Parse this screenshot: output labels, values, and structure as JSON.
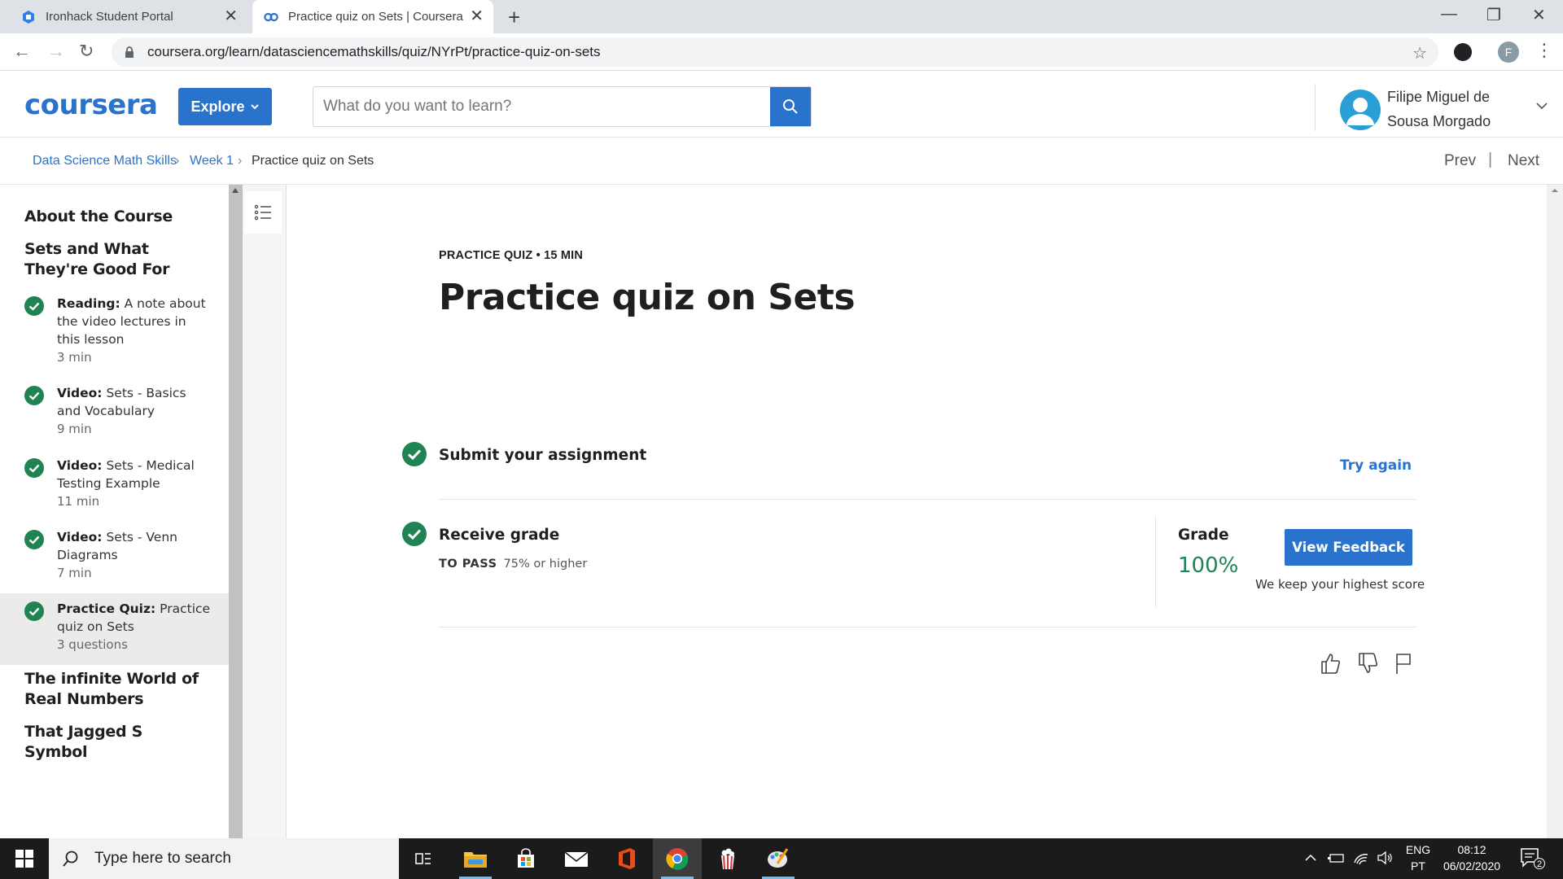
{
  "browser": {
    "tabs": [
      {
        "title": "Ironhack Student Portal",
        "icon": "ironhack-favicon"
      },
      {
        "title": "Practice quiz on Sets | Coursera",
        "icon": "coursera-favicon"
      }
    ],
    "url": "coursera.org/learn/datasciencemathskills/quiz/NYrPt/practice-quiz-on-sets",
    "profile_initial": "F"
  },
  "header": {
    "logo": "coursera",
    "explore_label": "Explore",
    "search_placeholder": "What do you want to learn?",
    "user_name_line1": "Filipe Miguel de",
    "user_name_line2": "Sousa Morgado"
  },
  "breadcrumb": {
    "items": [
      "Data Science Math Skills",
      "Week 1",
      "Practice quiz on Sets"
    ],
    "separator": "›",
    "prev": "Prev",
    "divider": "|",
    "next": "Next"
  },
  "sidebar": {
    "sections": [
      "About the Course",
      "Sets and What They're Good For",
      "The infinite World of Real Numbers",
      "That Jagged S Symbol"
    ],
    "items": [
      {
        "type": "Reading:",
        "title": "A note about the video lectures in this lesson",
        "duration": "3 min"
      },
      {
        "type": "Video:",
        "title": "Sets - Basics and Vocabulary",
        "duration": "9 min"
      },
      {
        "type": "Video:",
        "title": "Sets - Medical Testing Example",
        "duration": "11 min"
      },
      {
        "type": "Video:",
        "title": "Sets - Venn Diagrams",
        "duration": "7 min"
      },
      {
        "type": "Practice Quiz:",
        "title": "Practice quiz on Sets",
        "duration": "3 questions"
      }
    ]
  },
  "main": {
    "kicker": "PRACTICE QUIZ • 15 MIN",
    "title": "Practice quiz on Sets",
    "submit_title": "Submit your assignment",
    "try_again": "Try again",
    "receive_title": "Receive grade",
    "to_pass_label": "TO PASS",
    "to_pass_value": "75% or higher",
    "grade_label": "Grade",
    "grade_value": "100%",
    "view_feedback": "View Feedback",
    "keep_note": "We keep your highest score"
  },
  "taskbar": {
    "search_placeholder": "Type here to search",
    "lang_top": "ENG",
    "lang_bottom": "PT",
    "time": "08:12",
    "date": "06/02/2020",
    "notifications": "2"
  },
  "colors": {
    "brand_blue": "#2a73cc",
    "success_green": "#1f8354",
    "taskbar": "#1b1b1b"
  }
}
